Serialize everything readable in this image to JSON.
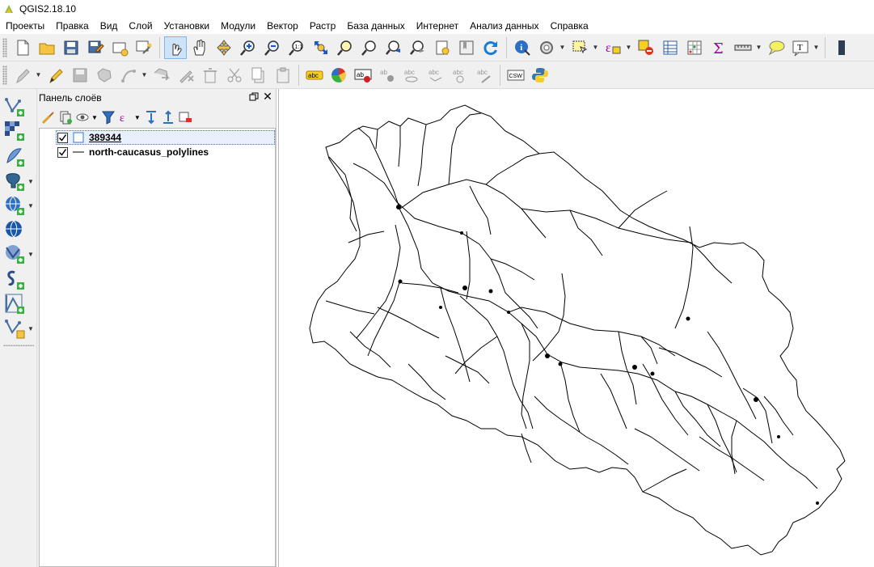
{
  "window": {
    "title": "QGIS2.18.10"
  },
  "menu": [
    "Проекты",
    "Правка",
    "Вид",
    "Слой",
    "Установки",
    "Модули",
    "Вектор",
    "Растр",
    "База данных",
    "Интернет",
    "Анализ данных",
    "Справка"
  ],
  "toolbar_main": [
    "new-project-icon",
    "open-project-icon",
    "save-project-icon",
    "save-as-icon",
    "new-print-composer-icon",
    "composer-manager-icon",
    "touch-zoom-icon",
    "pan-icon",
    "pan-to-selection-icon",
    "zoom-in-icon",
    "zoom-out-icon",
    "zoom-actual-size-icon",
    "zoom-full-icon",
    "zoom-to-selection-icon",
    "zoom-to-layer-icon",
    "zoom-last-icon",
    "zoom-next-icon",
    "new-bookmark-icon",
    "show-bookmarks-icon",
    "refresh-icon",
    "identify-icon",
    "map-tips-icon",
    "select-features-icon",
    "select-by-expression-icon",
    "deselect-icon",
    "attribute-table-icon",
    "field-calculator-icon",
    "statistics-icon",
    "measure-icon",
    "annotation-icon",
    "text-annotation-icon"
  ],
  "toolbar_digitize": [
    "current-edits-icon",
    "toggle-editing-icon",
    "save-edits-icon",
    "add-feature-icon",
    "move-feature-icon",
    "node-tool-icon",
    "delete-selected-icon",
    "cut-features-icon",
    "copy-features-icon",
    "paste-features-icon",
    "label-toolbar-icon",
    "diagram-icon",
    "pin-labels-icon",
    "show-hide-labels-icon",
    "move-label-icon",
    "rotate-label-icon",
    "change-label-icon",
    "metasearch-icon",
    "python-icon"
  ],
  "toolbar_digitize_csw": "CSW",
  "layers_panel": {
    "title": "Панель слоёв",
    "tools": [
      "add-group-icon",
      "manage-visibility-icon",
      "filter-legend-icon",
      "filter-by-expression-icon",
      "expand-all-icon",
      "collapse-all-icon",
      "remove-layer-icon"
    ]
  },
  "layers": [
    {
      "name": "389344",
      "checked": true,
      "symbol": "polygon",
      "selected": true
    },
    {
      "name": "north-caucasus_polylines",
      "checked": true,
      "symbol": "line",
      "selected": false
    }
  ],
  "left_toolbar": [
    "add-vector-layer-icon",
    "add-raster-layer-icon",
    "add-spatialite-layer-icon",
    "add-postgis-layer-icon",
    "add-wms-layer-icon",
    "add-wcs-layer-icon",
    "add-wfs-layer-icon",
    "add-delimited-text-layer-icon",
    "add-virtual-layer-icon",
    "new-shapefile-layer-icon"
  ],
  "colors": {
    "toolbar_bg": "#f0f0f0",
    "accent": "#3d74c9",
    "map_bg": "#ffffff",
    "roads": "#000000"
  }
}
